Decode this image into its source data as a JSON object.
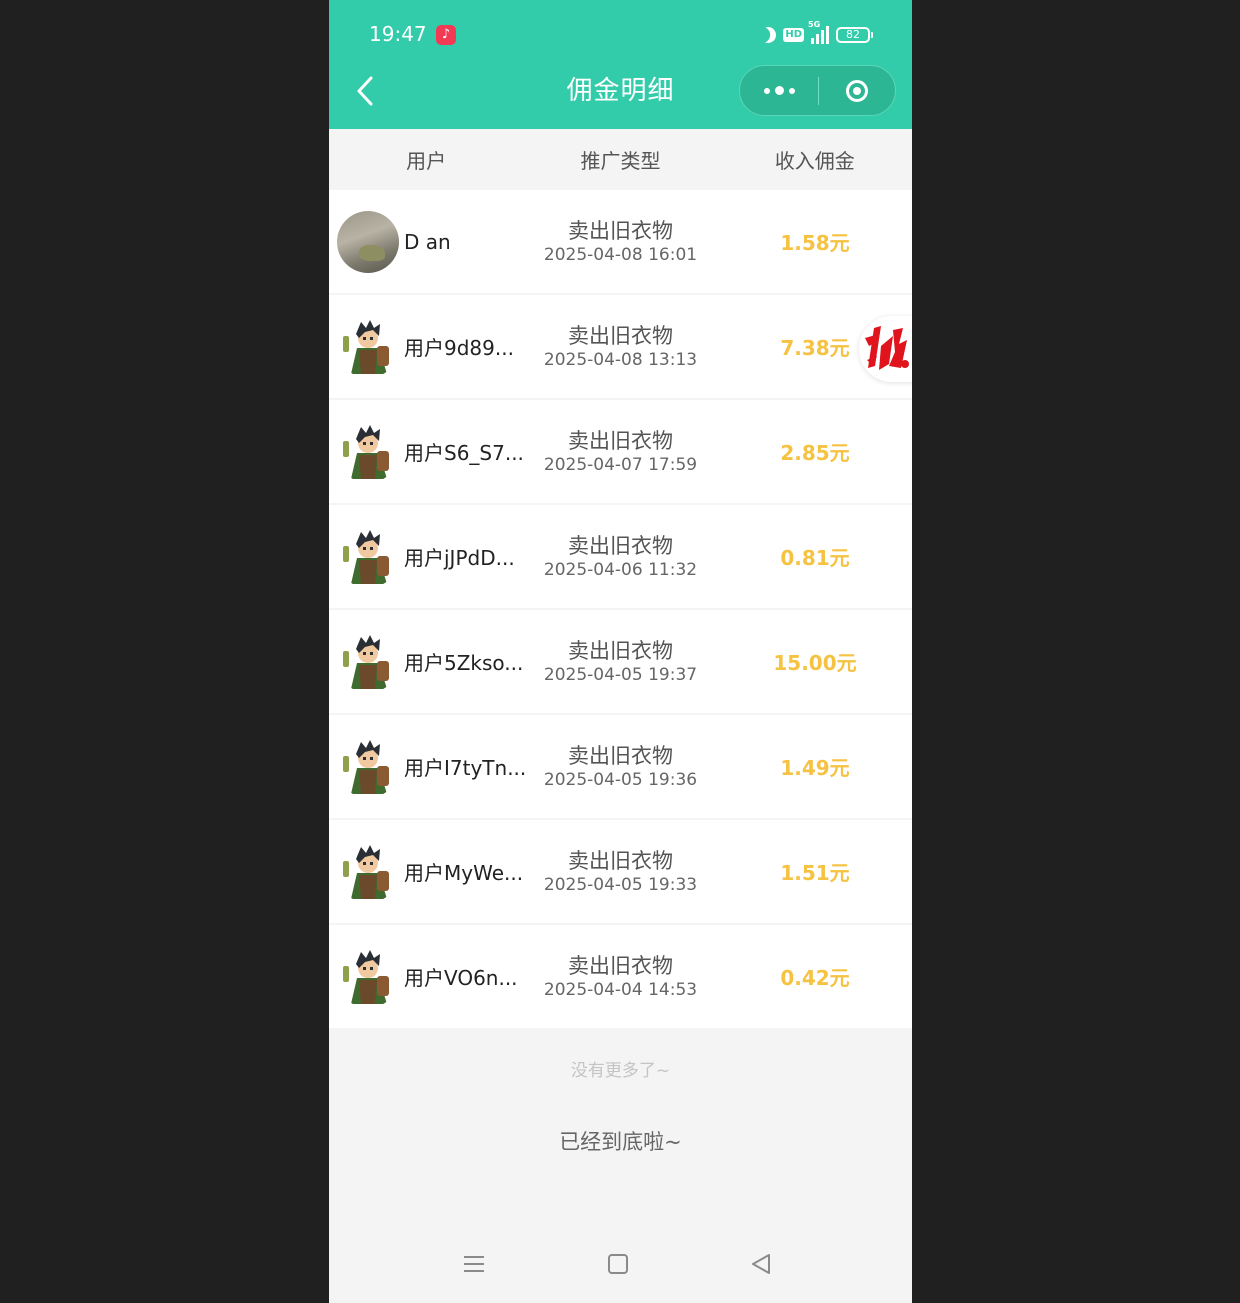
{
  "status_bar": {
    "time": "19:47",
    "network": "5G",
    "hd": "HD",
    "battery": "82"
  },
  "header": {
    "title": "佣金明细"
  },
  "columns": [
    "用户",
    "推广类型",
    "收入佣金"
  ],
  "records": [
    {
      "user": "D an",
      "avatar": "photo",
      "type": "卖出旧衣物",
      "time": "2025-04-08 16:01",
      "amount": "1.58元"
    },
    {
      "user": "用户9d89...",
      "avatar": "character",
      "type": "卖出旧衣物",
      "time": "2025-04-08 13:13",
      "amount": "7.38元"
    },
    {
      "user": "用户S6_S7...",
      "avatar": "character",
      "type": "卖出旧衣物",
      "time": "2025-04-07 17:59",
      "amount": "2.85元"
    },
    {
      "user": "用户jJPdD...",
      "avatar": "character",
      "type": "卖出旧衣物",
      "time": "2025-04-06 11:32",
      "amount": "0.81元"
    },
    {
      "user": "用户5Zkso...",
      "avatar": "character",
      "type": "卖出旧衣物",
      "time": "2025-04-05 19:37",
      "amount": "15.00元"
    },
    {
      "user": "用户I7tyTn...",
      "avatar": "character",
      "type": "卖出旧衣物",
      "time": "2025-04-05 19:36",
      "amount": "1.49元"
    },
    {
      "user": "用户MyWe...",
      "avatar": "character",
      "type": "卖出旧衣物",
      "time": "2025-04-05 19:33",
      "amount": "1.51元"
    },
    {
      "user": "用户VO6n...",
      "avatar": "character",
      "type": "卖出旧衣物",
      "time": "2025-04-04 14:53",
      "amount": "0.42元"
    }
  ],
  "footer": {
    "no_more": "没有更多了~",
    "bottom_reached": "已经到底啦~"
  },
  "colors": {
    "header_bg": "#33ccaa",
    "amount": "#f5c242",
    "page_bg": "#f4f4f4"
  },
  "icons": {
    "back": "chevron-left-icon",
    "more": "more-dots-icon",
    "close": "target-icon",
    "float_badge": "red-brush-logo-icon",
    "nav": [
      "menu-lines-icon",
      "square-home-icon",
      "triangle-back-icon"
    ]
  }
}
